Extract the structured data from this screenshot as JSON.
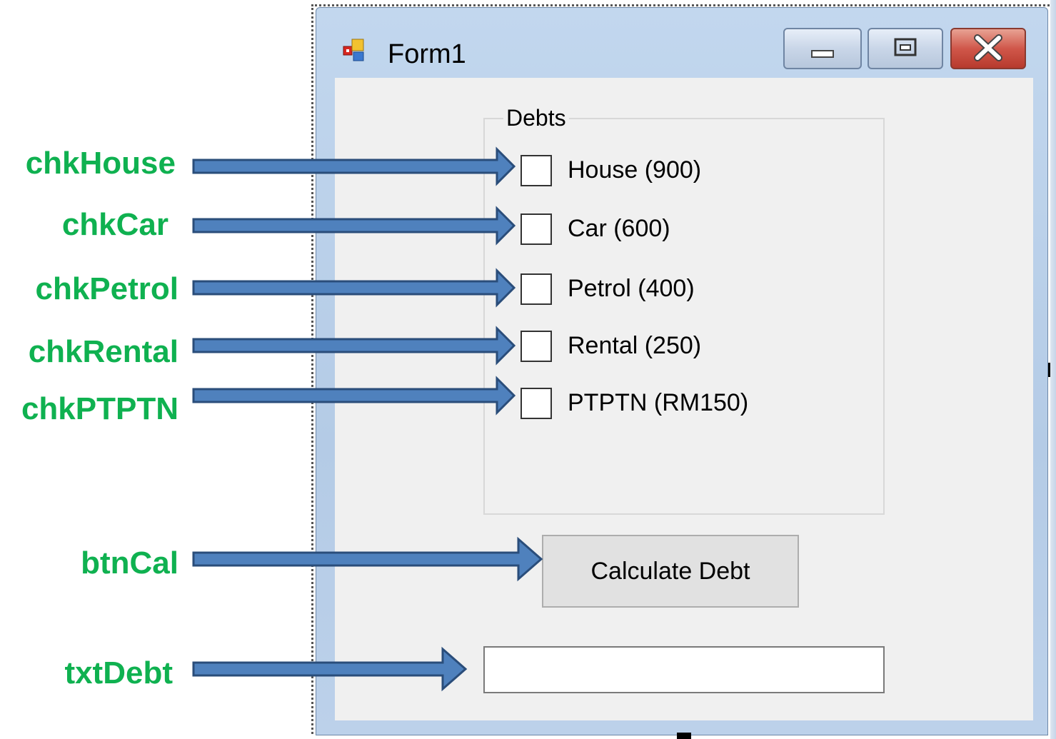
{
  "window": {
    "title": "Form1",
    "caption_buttons": [
      "minimize",
      "maximize",
      "close"
    ]
  },
  "debts_group": {
    "title": "Debts",
    "checkboxes": [
      {
        "id": "chkHouse",
        "label": "House (900)",
        "checked": false
      },
      {
        "id": "chkCar",
        "label": "Car (600)",
        "checked": false
      },
      {
        "id": "chkPetrol",
        "label": "Petrol (400)",
        "checked": false
      },
      {
        "id": "chkRental",
        "label": "Rental (250)",
        "checked": false
      },
      {
        "id": "chkPTPTN",
        "label": "PTPTN (RM150)",
        "checked": false
      }
    ]
  },
  "calculate_button": {
    "label": "Calculate Debt"
  },
  "debt_textbox": {
    "value": ""
  },
  "annotations": {
    "chkHouse": "chkHouse",
    "chkCar": "chkCar",
    "chkPetrol": "chkPetrol",
    "chkRental": "chkRental",
    "chkPTPTN": "chkPTPTN",
    "btnCal": "btnCal",
    "txtDebt": "txtDebt"
  },
  "colors": {
    "annotation_text": "#0fb150",
    "arrow_fill": "#4f81bd",
    "arrow_stroke": "#2a4d7a",
    "form_background": "#f0f0f0"
  }
}
